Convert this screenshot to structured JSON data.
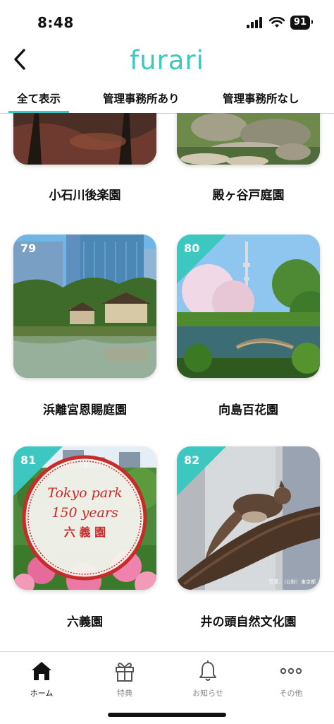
{
  "status": {
    "time": "8:48",
    "battery": "91"
  },
  "app": {
    "logo": "furari"
  },
  "tabs": [
    {
      "label": "全て表示",
      "active": true
    },
    {
      "label": "管理事務所あり",
      "active": false
    },
    {
      "label": "管理事務所なし",
      "active": false
    }
  ],
  "gardens": [
    {
      "name": "小石川後楽園"
    },
    {
      "name": "殿ヶ谷戸庭園"
    },
    {
      "number": "79",
      "name": "浜離宮恩賜庭園"
    },
    {
      "number": "80",
      "name": "向島百花園"
    },
    {
      "number": "81",
      "name": "六義園",
      "overlay": [
        "Tokyo park",
        "150 years",
        "六 義 園"
      ]
    },
    {
      "number": "82",
      "name": "井の頭自然文化園",
      "credit": "写真：（公財）東京都"
    }
  ],
  "bottom_nav": [
    {
      "label": "ホーム",
      "icon": "home-icon",
      "active": true
    },
    {
      "label": "特典",
      "icon": "gift-icon",
      "active": false
    },
    {
      "label": "お知らせ",
      "icon": "bell-icon",
      "active": false
    },
    {
      "label": "その他",
      "icon": "more-icon",
      "active": false
    }
  ],
  "colors": {
    "accent": "#3cc8c0",
    "text": "#111111",
    "inactive": "#888888"
  }
}
